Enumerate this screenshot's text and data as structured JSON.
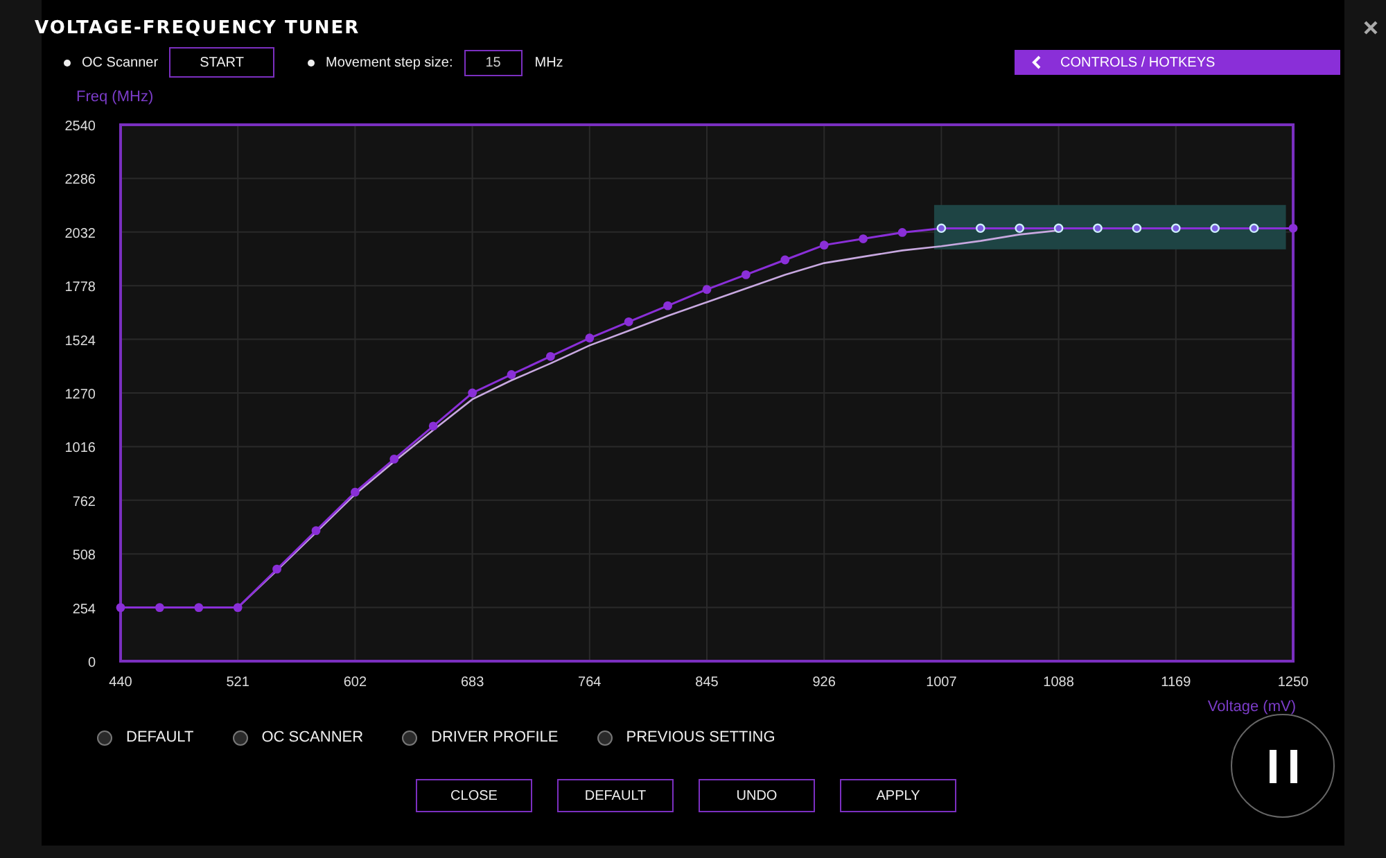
{
  "window": {
    "title": "VOLTAGE-FREQUENCY TUNER"
  },
  "toolbar": {
    "oc_scanner_label": "OC Scanner",
    "start_button": "START",
    "step_label": "Movement step size:",
    "step_value": "15",
    "step_unit": "MHz",
    "controls_button": "CONTROLS / HOTKEYS"
  },
  "chart": {
    "chart_data": {
      "type": "line",
      "xlabel": "Voltage (mV)",
      "ylabel": "Freq (MHz)",
      "grid": true,
      "xlim": [
        440,
        1250
      ],
      "ylim": [
        0,
        2540
      ],
      "xticks": [
        440,
        521,
        602,
        683,
        764,
        845,
        926,
        1007,
        1088,
        1169,
        1250
      ],
      "yticks": [
        0,
        254,
        508,
        762,
        1016,
        1270,
        1524,
        1778,
        2032,
        2286,
        2540
      ],
      "x": [
        440,
        467,
        494,
        521,
        548,
        575,
        602,
        629,
        656,
        683,
        710,
        737,
        764,
        791,
        818,
        845,
        872,
        899,
        926,
        953,
        980,
        1007,
        1034,
        1061,
        1088,
        1115,
        1142,
        1169,
        1196,
        1223,
        1250
      ],
      "series": [
        {
          "color": "#8a2fd8",
          "marker": "circle",
          "values": [
            254,
            254,
            254,
            254,
            436,
            618,
            800,
            957,
            1113,
            1270,
            1357,
            1443,
            1530,
            1607,
            1683,
            1760,
            1830,
            1900,
            1970,
            2000,
            2030,
            2050,
            2050,
            2050,
            2050,
            2050,
            2050,
            2050,
            2050,
            2050,
            2050
          ]
        },
        {
          "color": "#c8a8e0",
          "values": [
            null,
            null,
            null,
            254,
            430,
            610,
            790,
            945,
            1095,
            1240,
            1330,
            1410,
            1495,
            1565,
            1635,
            1700,
            1765,
            1830,
            1885,
            1915,
            1945,
            1965,
            1990,
            2020,
            2040,
            null,
            null,
            null,
            null,
            null,
            null
          ]
        }
      ]
    }
  },
  "presets": [
    {
      "label": "DEFAULT",
      "selected": false
    },
    {
      "label": "OC SCANNER",
      "selected": false
    },
    {
      "label": "DRIVER PROFILE",
      "selected": false
    },
    {
      "label": "PREVIOUS SETTING",
      "selected": false
    }
  ],
  "buttons": [
    "CLOSE",
    "DEFAULT",
    "UNDO",
    "APPLY"
  ]
}
